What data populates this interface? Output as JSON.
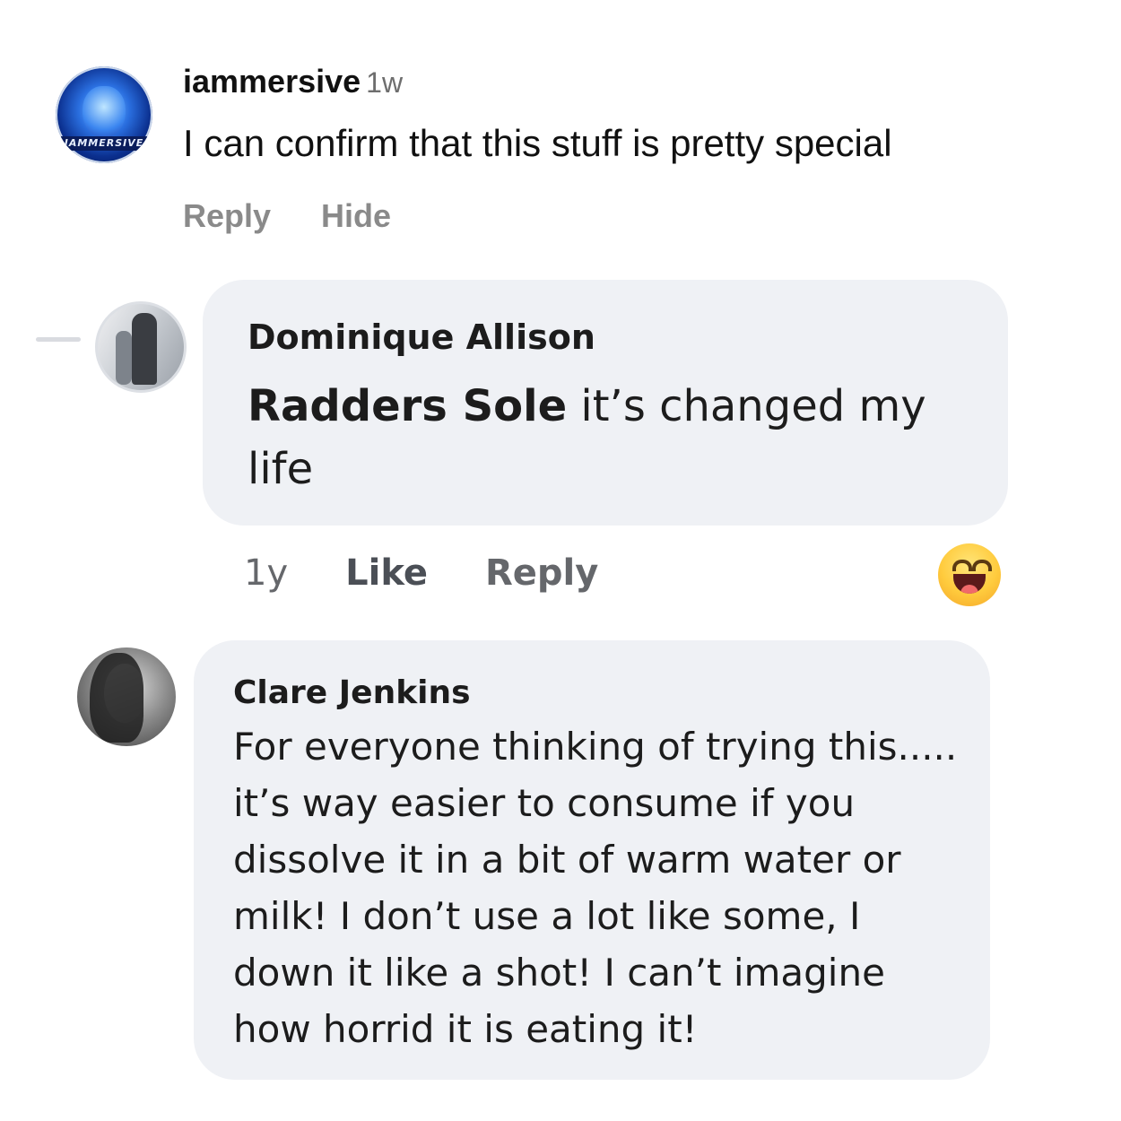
{
  "top_comment": {
    "username": "iammersive",
    "time": "1w",
    "text": "I can confirm that this stuff is pretty special",
    "actions": {
      "reply": "Reply",
      "hide": "Hide"
    },
    "avatar_brand": "IAMMERSIVE"
  },
  "comment_1": {
    "author": "Dominique Allison",
    "mention": "Radders Sole",
    "text_line1": " it’s changed my",
    "text_line2": "life",
    "age": "1y",
    "like_label": "Like",
    "reply_label": "Reply",
    "reaction": "haha"
  },
  "comment_2": {
    "author": "Clare Jenkins",
    "lines": [
      "For everyone thinking of trying this.....",
      "it’s way easier to consume if you",
      "dissolve it in a bit of warm water or",
      "milk! I don’t use a lot like some, I",
      "down it like a shot! I can’t imagine",
      "how horrid it is eating it!"
    ]
  }
}
